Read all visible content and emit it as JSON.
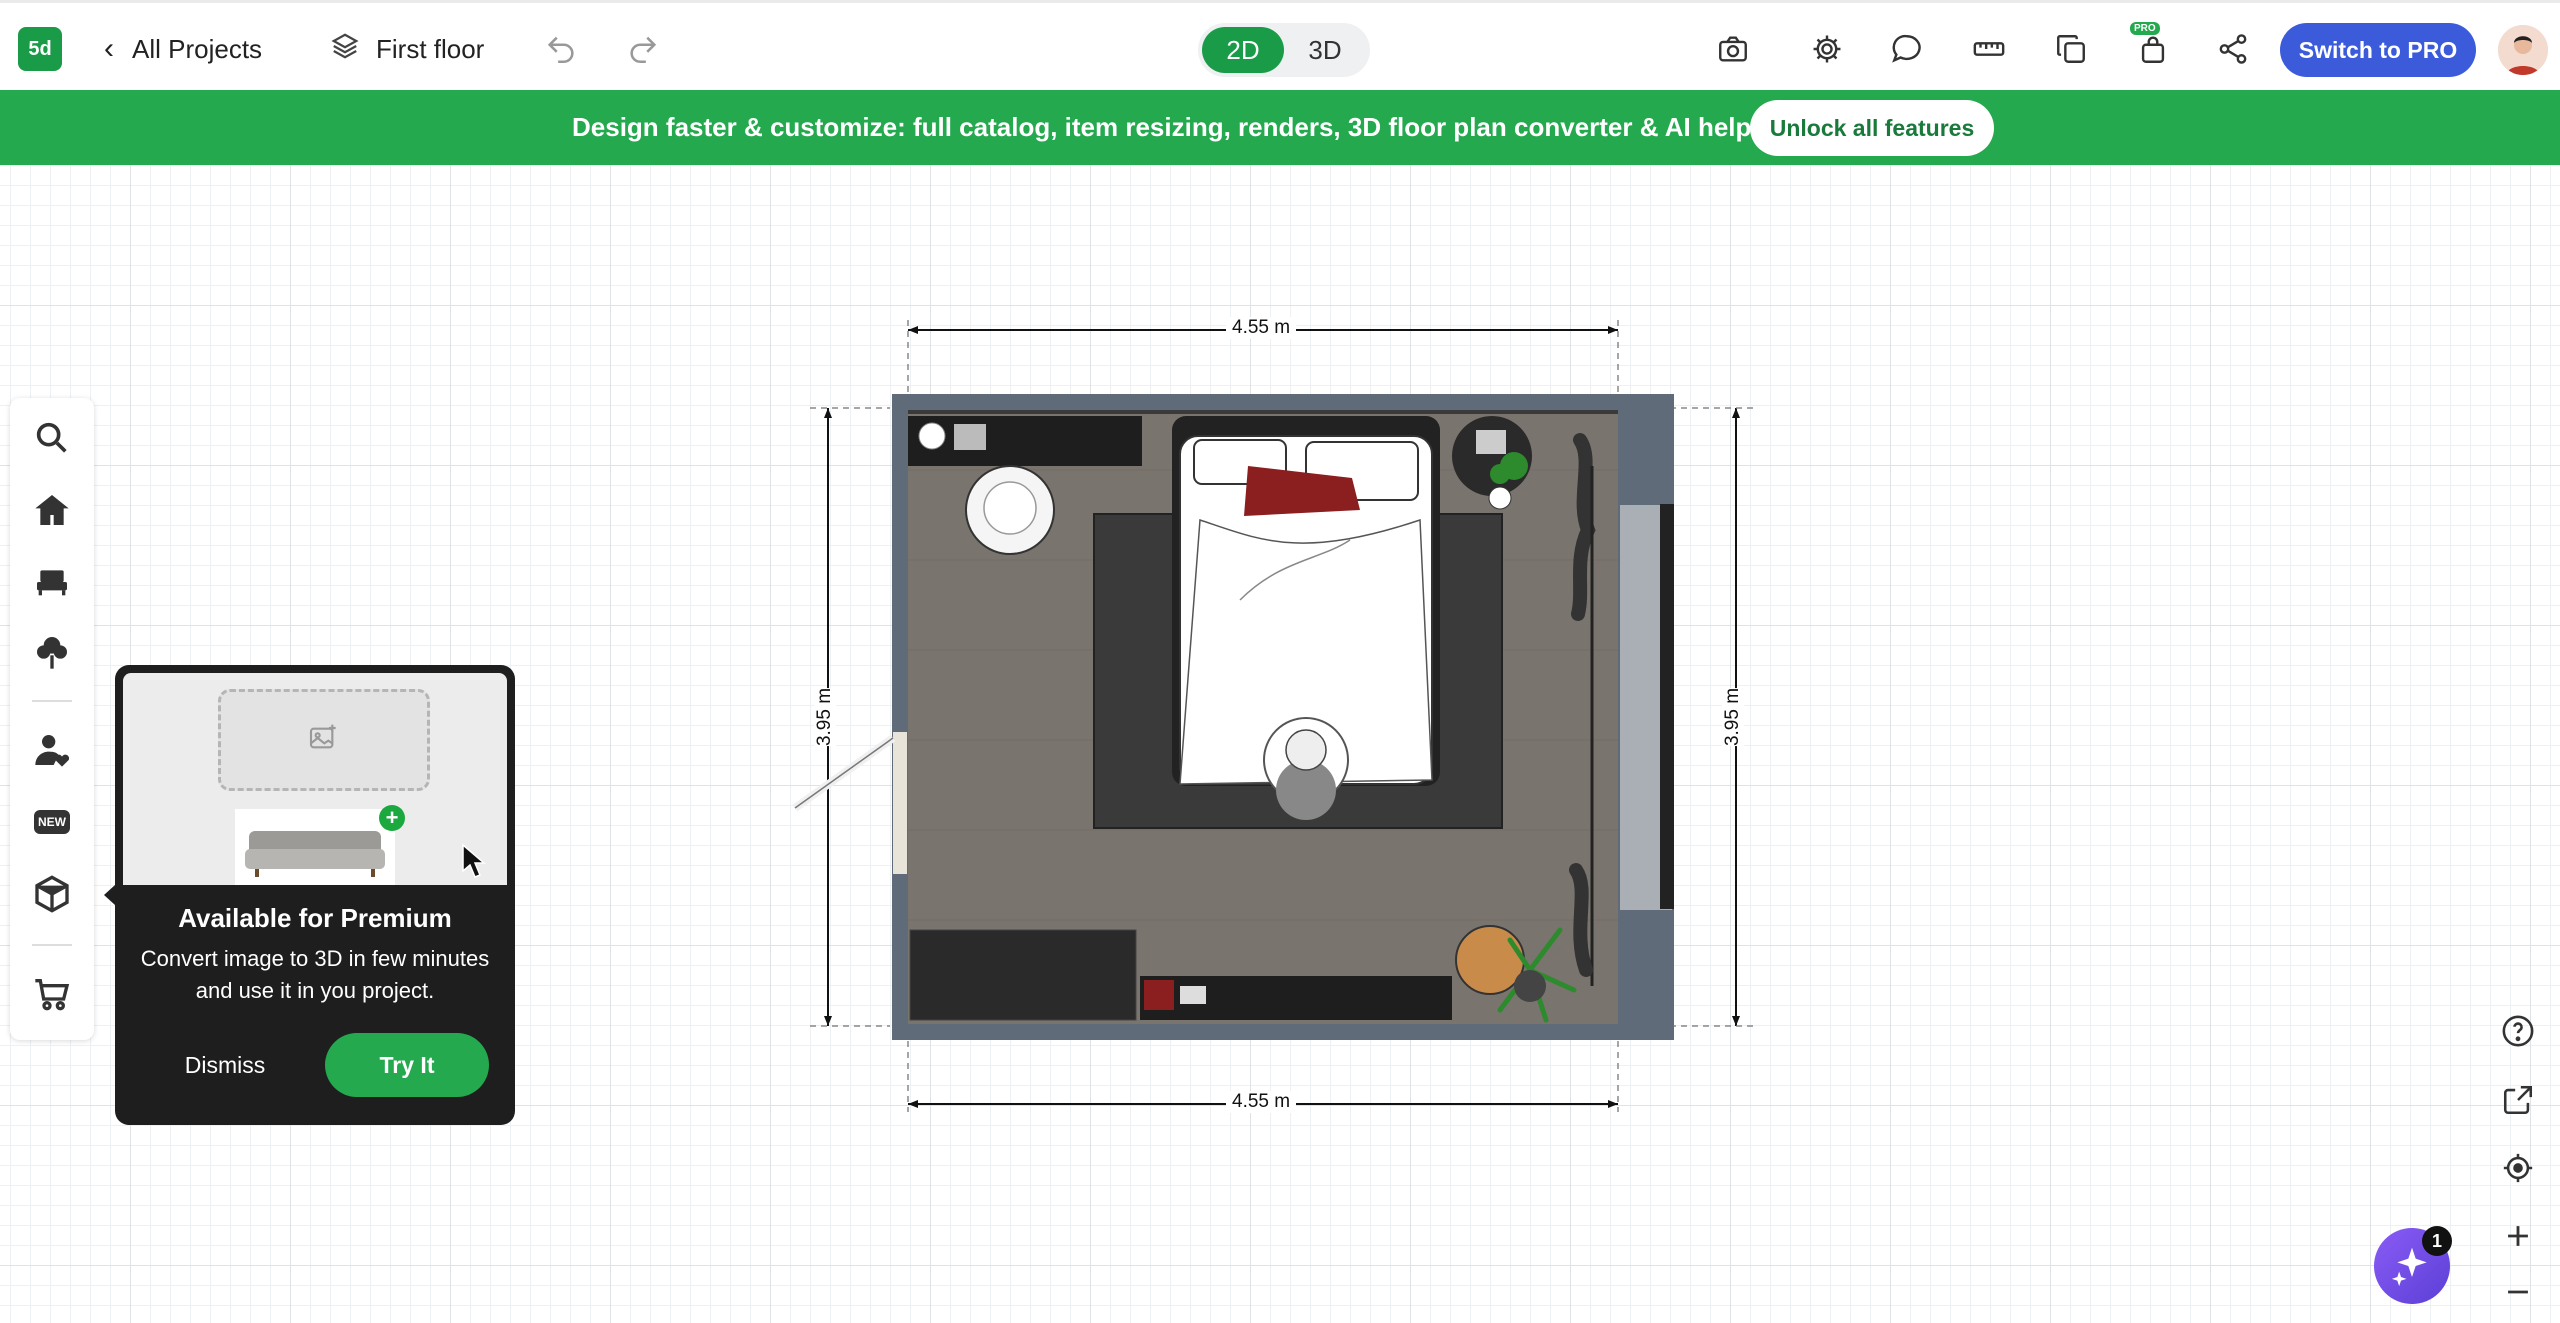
{
  "topbar": {
    "logo_text": "5d",
    "back_label": "All Projects",
    "floor_label": "First floor",
    "view_2d": "2D",
    "view_3d": "3D",
    "switch_pro_label": "Switch to PRO",
    "pro_badge": "PRO",
    "icons": [
      "undo-icon",
      "redo-icon",
      "camera-icon",
      "gear-icon",
      "chat-icon",
      "ruler-icon",
      "copy-icon",
      "pro-icon",
      "share-icon"
    ]
  },
  "banner": {
    "text": "Design faster & customize: full catalog, item resizing, renders, 3D floor plan converter & AI help",
    "button_label": "Unlock all features",
    "color": "#25a94f"
  },
  "left_toolbar": {
    "items": [
      "search-icon",
      "home-icon",
      "furniture-icon",
      "tree-icon",
      "user-heart-icon",
      "new-icon",
      "3d-box-icon",
      "cart-icon"
    ],
    "new_label": "NEW"
  },
  "popup": {
    "title": "Available for Premium",
    "description": "Convert image to 3D in few minutes and use it in you project.",
    "dismiss_label": "Dismiss",
    "try_label": "Try It"
  },
  "floorplan": {
    "dim_top": "4.55 m",
    "dim_bottom": "4.55 m",
    "dim_left": "3.95 m",
    "dim_right": "3.95 m"
  },
  "right_tools": {
    "icons": [
      "help-icon",
      "external-link-icon",
      "locate-icon",
      "zoom-in-icon",
      "zoom-out-icon"
    ],
    "ai_badge_count": "1"
  },
  "colors": {
    "accent_green": "#1a9b48",
    "pro_blue": "#3b5bdb"
  }
}
